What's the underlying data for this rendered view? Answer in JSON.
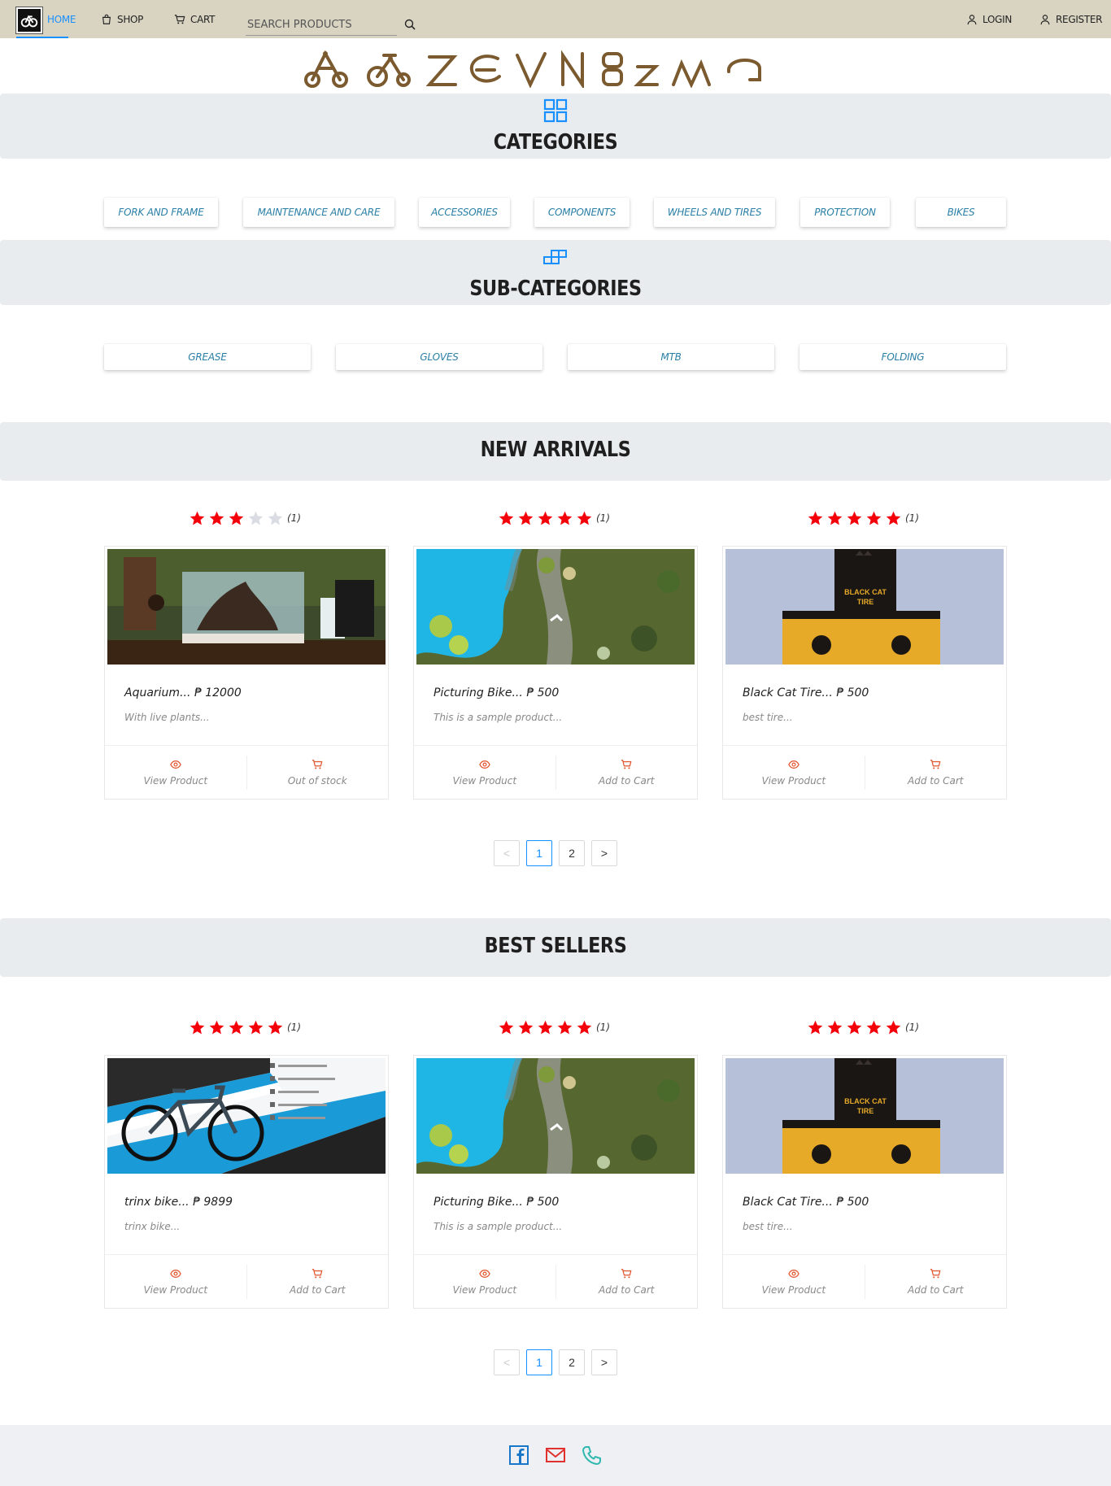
{
  "nav": {
    "home": "HOME",
    "shop": "SHOP",
    "cart": "CART",
    "search_placeholder": "SEARCH PRODUCTS",
    "login": "LOGIN",
    "register": "REGISTER",
    "accent": "#1890ff"
  },
  "sections": {
    "categories_title": "CATEGORIES",
    "subcategories_title": "SUB-CATEGORIES",
    "new_arrivals_title": "NEW ARRIVALS",
    "best_sellers_title": "BEST SELLERS"
  },
  "categories": [
    "FORK AND FRAME",
    "MAINTENANCE AND CARE",
    "ACCESSORIES",
    "COMPONENTS",
    "WHEELS AND TIRES",
    "PROTECTION",
    "BIKES"
  ],
  "subcategories": [
    "GREASE",
    "GLOVES",
    "MTB",
    "FOLDING"
  ],
  "new_arrivals": [
    {
      "rating": 3,
      "count": "(1)",
      "title": "Aquarium... ₱ 12000",
      "desc": "With live plants...",
      "view": "View Product",
      "cart": "Out of stock",
      "image": "aquarium"
    },
    {
      "rating": 5,
      "count": "(1)",
      "title": "Picturing Bike... ₱ 500",
      "desc": "This is a sample product...",
      "view": "View Product",
      "cart": "Add to Cart",
      "image": "pool"
    },
    {
      "rating": 5,
      "count": "(1)",
      "title": "Black Cat Tire... ₱ 500",
      "desc": "best tire...",
      "view": "View Product",
      "cart": "Add to Cart",
      "image": "blackcat"
    }
  ],
  "best_sellers": [
    {
      "rating": 5,
      "count": "(1)",
      "title": "trinx bike... ₱ 9899",
      "desc": "trinx bike...",
      "view": "View Product",
      "cart": "Add to Cart",
      "image": "bike"
    },
    {
      "rating": 5,
      "count": "(1)",
      "title": "Picturing Bike... ₱ 500",
      "desc": "This is a sample product...",
      "view": "View Product",
      "cart": "Add to Cart",
      "image": "pool"
    },
    {
      "rating": 5,
      "count": "(1)",
      "title": "Black Cat Tire... ₱ 500",
      "desc": "best tire...",
      "view": "View Product",
      "cart": "Add to Cart",
      "image": "blackcat"
    }
  ],
  "pagination": {
    "prev": "<",
    "pages": [
      "1",
      "2"
    ],
    "next": ">",
    "current": "1"
  },
  "blackcat_label": "BLACK CAT TIRE",
  "colors": {
    "star_on": "#f5000a",
    "star_off": "#d9dce3",
    "band": "#e9ecef",
    "category_text": "#2a7fa5",
    "action_icon": "#e0542c"
  },
  "footer_icons": [
    "facebook-icon",
    "mail-icon",
    "phone-icon"
  ]
}
